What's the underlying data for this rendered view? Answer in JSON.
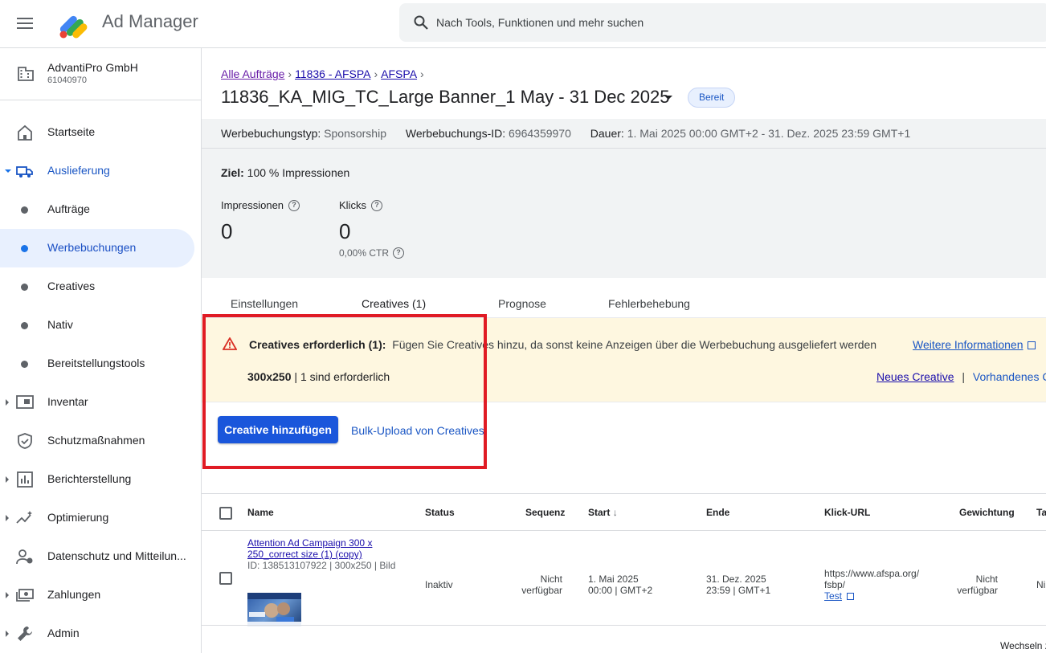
{
  "app": {
    "title": "Ad Manager"
  },
  "search": {
    "placeholder": "Nach Tools, Funktionen und mehr suchen"
  },
  "account": {
    "name": "AdvantiPro GmbH",
    "id": "61040970"
  },
  "sidebar": {
    "items": [
      {
        "label": "Startseite"
      },
      {
        "label": "Auslieferung"
      },
      {
        "label": "Aufträge"
      },
      {
        "label": "Werbebuchungen"
      },
      {
        "label": "Creatives"
      },
      {
        "label": "Nativ"
      },
      {
        "label": "Bereitstellungstools"
      },
      {
        "label": "Inventar"
      },
      {
        "label": "Schutzmaßnahmen"
      },
      {
        "label": "Berichterstellung"
      },
      {
        "label": "Optimierung"
      },
      {
        "label": "Datenschutz und Mitteilun..."
      },
      {
        "label": "Zahlungen"
      },
      {
        "label": "Admin"
      }
    ]
  },
  "breadcrumb": {
    "b1": "Alle Aufträge",
    "b2": "11836 - AFSPA",
    "b3": "AFSPA"
  },
  "page": {
    "title": "11836_KA_MIG_TC_Large Banner_1 May - 31 Dec 2025",
    "status": "Bereit"
  },
  "meta": {
    "type_label": "Werbebuchungstyp:",
    "type_value": "Sponsorship",
    "id_label": "Werbebuchungs-ID:",
    "id_value": "6964359970",
    "dur_label": "Dauer:",
    "dur_value": "1. Mai 2025 00:00 GMT+2 - 31. Dez. 2025 23:59 GMT+1"
  },
  "goal": {
    "label": "Ziel:",
    "value": "100 % Impressionen"
  },
  "stats": {
    "impressions_label": "Impressionen",
    "impressions_value": "0",
    "clicks_label": "Klicks",
    "clicks_value": "0",
    "ctr": "0,00% CTR"
  },
  "tabs": {
    "t1": "Einstellungen",
    "t2": "Creatives (1)",
    "t3": "Prognose",
    "t4": "Fehlerbehebung"
  },
  "warning": {
    "title": "Creatives erforderlich (1):",
    "text": "Fügen Sie Creatives hinzu, da sonst keine Anzeigen über die Werbebuchung ausgeliefert werden",
    "more": "Weitere Informationen",
    "size": "300x250",
    "size_sep": " | ",
    "required": "1 sind erforderlich",
    "new_creative": "Neues Creative",
    "link_sep": "|",
    "existing": "Vorhandenes Cr"
  },
  "actions": {
    "add": "Creative hinzufügen",
    "bulk": "Bulk-Upload von Creatives"
  },
  "table": {
    "headers": {
      "name": "Name",
      "status": "Status",
      "sequence": "Sequenz",
      "start": "Start",
      "end": "Ende",
      "click_url": "Klick-URL",
      "weight": "Gewichtung",
      "ta": "Ta"
    },
    "row": {
      "name_l1": "Attention Ad Campaign 300 x",
      "name_l2": "250_correct size (1) (copy)",
      "sub": "ID: 138513107922 | 300x250 | Bild",
      "status": "Inaktiv",
      "seq_l1": "Nicht",
      "seq_l2": "verfügbar",
      "start_l1": "1. Mai 2025",
      "start_l2": "00:00 | GMT+2",
      "end_l1": "31. Dez. 2025",
      "end_l2": "23:59 | GMT+1",
      "url_l1": "https://www.afspa.org/",
      "url_l2": "fsbp/",
      "test": "Test",
      "weight_l1": "Nicht",
      "weight_l2": "verfügbar",
      "ta": "Ni"
    },
    "footer": "Wechseln z"
  },
  "colors": {
    "accent": "#1a56db",
    "highlight_box": "#e01b24",
    "warning_bg": "#fef7e0"
  }
}
